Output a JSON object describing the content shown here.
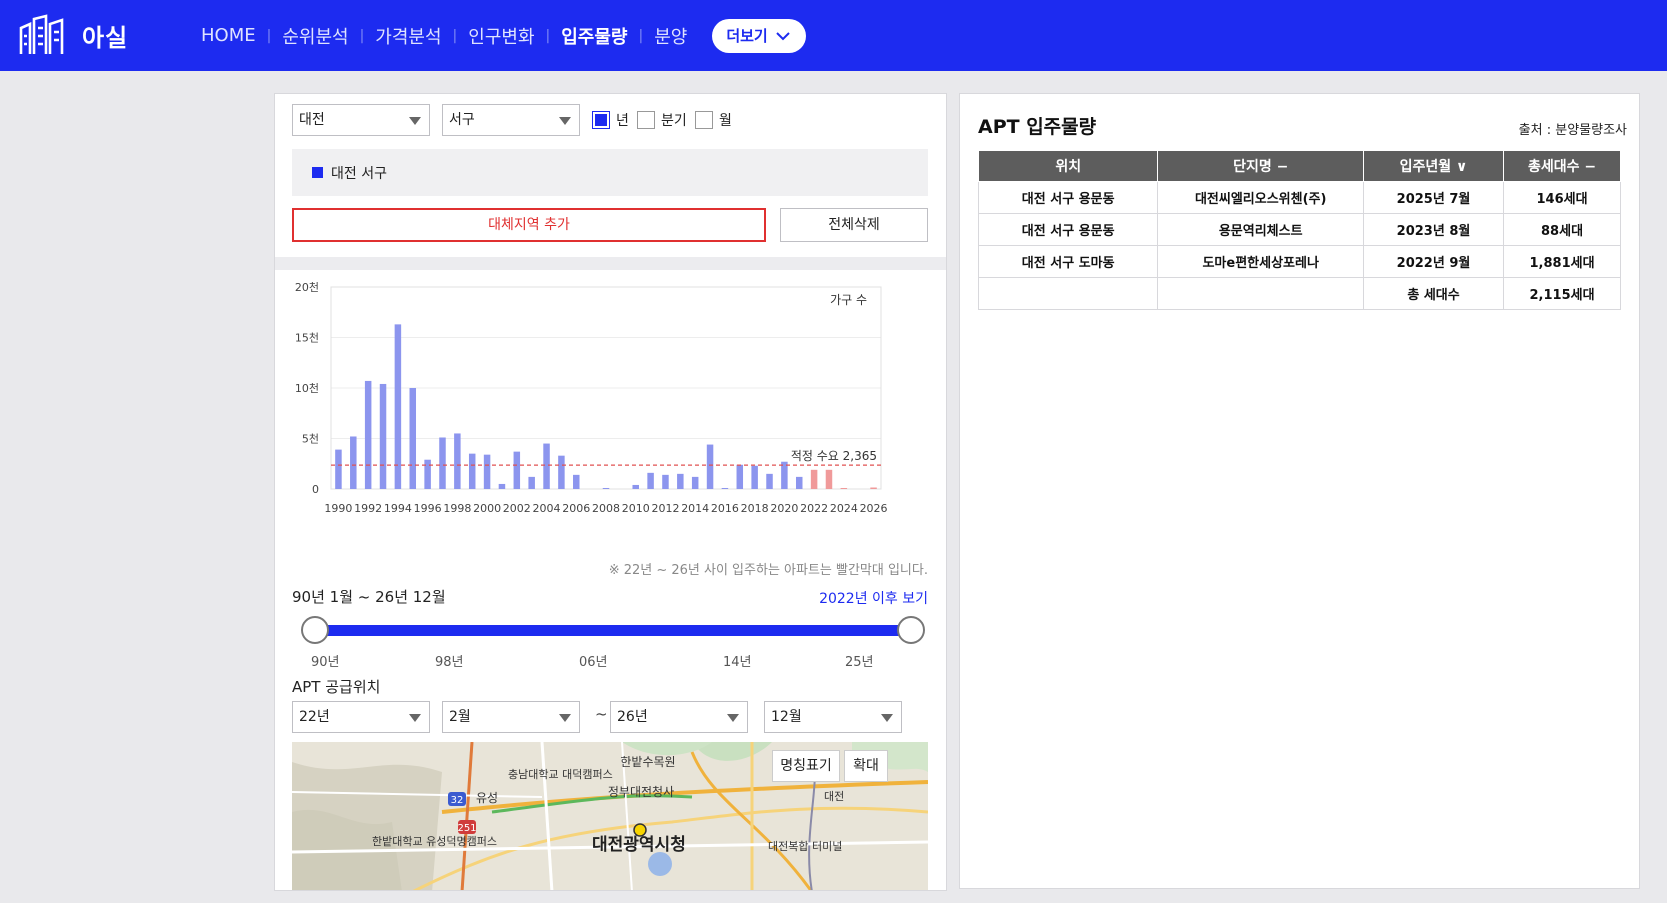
{
  "brand": {
    "name": "아실"
  },
  "nav": {
    "items": [
      {
        "label": "HOME"
      },
      {
        "label": "순위분석"
      },
      {
        "label": "가격분석"
      },
      {
        "label": "인구변화"
      },
      {
        "label": "입주물량"
      },
      {
        "label": "분양"
      }
    ],
    "active_index": 4,
    "more_label": "더보기"
  },
  "filters": {
    "city": "대전",
    "district": "서구",
    "period_options": [
      "년",
      "분기",
      "월"
    ],
    "period_selected": "년"
  },
  "selected_region": "대전 서구",
  "buttons": {
    "add_region": "대체지역 추가",
    "delete_all": "전체삭제"
  },
  "chart_data": {
    "type": "bar",
    "legend": "가구 수",
    "ylim": [
      0,
      20000
    ],
    "y_ticks": [
      "0",
      "5천",
      "10천",
      "15천",
      "20천"
    ],
    "y_tick_values": [
      0,
      5000,
      10000,
      15000,
      20000
    ],
    "x_tick_labels": [
      "1990",
      "1992",
      "1994",
      "1996",
      "1998",
      "2000",
      "2002",
      "2004",
      "2006",
      "2008",
      "2010",
      "2012",
      "2014",
      "2016",
      "2018",
      "2020",
      "2022",
      "2024",
      "2026"
    ],
    "categories": [
      "1990",
      "1991",
      "1992",
      "1993",
      "1994",
      "1995",
      "1996",
      "1997",
      "1998",
      "1999",
      "2000",
      "2001",
      "2002",
      "2003",
      "2004",
      "2005",
      "2006",
      "2007",
      "2008",
      "2009",
      "2010",
      "2011",
      "2012",
      "2013",
      "2014",
      "2015",
      "2016",
      "2017",
      "2018",
      "2019",
      "2020",
      "2021",
      "2022",
      "2023",
      "2024",
      "2025",
      "2026"
    ],
    "values": [
      3900,
      5200,
      10700,
      10400,
      16300,
      10000,
      2900,
      5100,
      5500,
      3500,
      3400,
      500,
      3700,
      1200,
      4500,
      3300,
      1400,
      0,
      100,
      0,
      400,
      1600,
      1400,
      1500,
      1200,
      4400,
      100,
      2400,
      2300,
      1500,
      2700,
      1200,
      1900,
      1900,
      100,
      0,
      146
    ],
    "highlight_from": "2022",
    "colors": {
      "normal": "#8c95ee",
      "highlight": "#f09a9a",
      "demand_line": "#e05050"
    },
    "reference_line": {
      "label": "적정 수요 2,365",
      "value": 2365
    }
  },
  "note": "※ 22년 ~ 26년 사이 입주하는 아파트는 빨간막대 입니다.",
  "range": {
    "label": "90년 1월 ~ 26년 12월",
    "after_link": "2022년 이후 보기",
    "ticks": [
      "90년",
      "98년",
      "06년",
      "14년",
      "25년"
    ],
    "start_fraction": 0,
    "end_fraction": 1
  },
  "location": {
    "title": "APT 공급위치",
    "from_year": "22년",
    "from_month": "2월",
    "to_year": "26년",
    "to_month": "12월",
    "tilde": "~"
  },
  "map": {
    "name_button": "명칭표기",
    "zoom_button": "확대",
    "labels": [
      "한밭수목원",
      "충남대학교 대덕캠퍼스",
      "유성",
      "정부대전청사",
      "대전광역시청",
      "한밭대학교 유성덕명캠퍼스",
      "대전복합 터미널",
      "대전",
      "32",
      "251"
    ]
  },
  "table": {
    "title": "APT 입주물량",
    "source": "출처 : 분양물량조사",
    "headers": [
      "위치",
      "단지명 −",
      "입주년월 ∨",
      "총세대수 −"
    ],
    "rows": [
      [
        "대전 서구 용문동",
        "대전씨엘리오스위첸(주)",
        "2025년 7월",
        "146세대"
      ],
      [
        "대전 서구 용문동",
        "용문역리체스트",
        "2023년 8월",
        "88세대"
      ],
      [
        "대전 서구 도마동",
        "도마e편한세상포레나",
        "2022년 9월",
        "1,881세대"
      ]
    ],
    "total_label": "총 세대수",
    "total_value": "2,115세대"
  }
}
